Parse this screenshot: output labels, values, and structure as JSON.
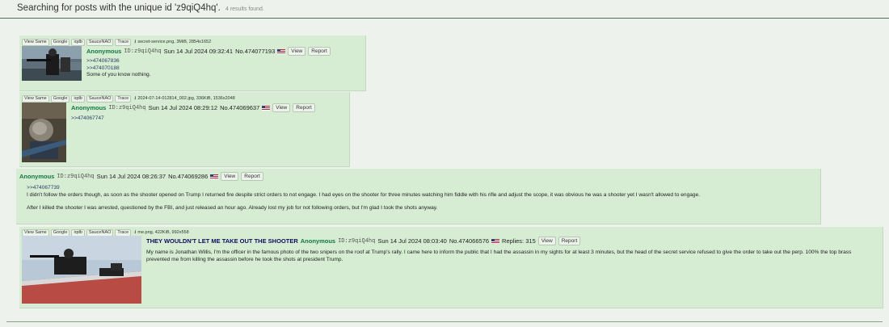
{
  "search": {
    "message": "Searching for posts with the unique id 'z9qiQ4hq'.",
    "count": "4 results found."
  },
  "tools": [
    "View Same",
    "Google",
    "iqdb",
    "SauceNAO",
    "Trace"
  ],
  "posts": [
    {
      "file": "secret-service.png, 3MiB, 2854x1652",
      "name": "Anonymous",
      "id": "ID:z9qiQ4hq",
      "datetime": "Sun 14 Jul 2024 09:32:41",
      "no": "No.474077193",
      "view": "View",
      "report": "Report",
      "quotes": [
        ">>474067836",
        ">>474070188"
      ],
      "text": "Some of you know nothing."
    },
    {
      "file": "2024-07-14-012814_002.jpg, 336KiB, 1536x2048",
      "name": "Anonymous",
      "id": "ID:z9qiQ4hq",
      "datetime": "Sun 14 Jul 2024 08:29:12",
      "no": "No.474069637",
      "view": "View",
      "report": "Report",
      "quotes": [
        ">>474067747"
      ]
    },
    {
      "name": "Anonymous",
      "id": "ID:z9qiQ4hq",
      "datetime": "Sun 14 Jul 2024 08:26:37",
      "no": "No.474069286",
      "view": "View",
      "report": "Report",
      "quotes": [
        ">>474067739"
      ],
      "text1": "I didn't follow the orders though, as soon as the shooter opened on Trump I returned fire despite strict orders to not engage. I had eyes on the shooter for three minutes watching him fiddle with his rifle and adjust the scope, it was obvious he was a shooter yet I wasn't allowed to engage.",
      "text2": "After I killed the shooter I was arrested, questioned by the FBI, and just released an hour ago. Already lost my job for not following orders, but I'm glad I took the shots anyway."
    },
    {
      "file": "me.png, 422KiB, 992x558",
      "subject": "THEY WOULDN'T LET ME TAKE OUT THE SHOOTER",
      "name": "Anonymous",
      "id": "ID:z9qiQ4hq",
      "datetime": "Sun 14 Jul 2024 08:03:40",
      "no": "No.474066576",
      "replies": "Replies: 315",
      "view": "View",
      "report": "Report",
      "text": "My name is Jonathan Willis, I'm the officer in the famous photo of the two snipers on the roof at Trump's rally. I came here to inform the public that I had the assassin in my sights for at least 3 minutes, but the head of the secret service refused to give the order to take out the perp. 100% the top brass prevented me from killing the assassin before he took the shots at president Trump."
    }
  ],
  "colors": {
    "name": "#117743",
    "subject": "#0f0c5d",
    "post_bg": "#d6edd3",
    "page_bg": "#eef2ec"
  },
  "icons": {
    "download": "download-icon",
    "flag": "us-flag-icon"
  }
}
